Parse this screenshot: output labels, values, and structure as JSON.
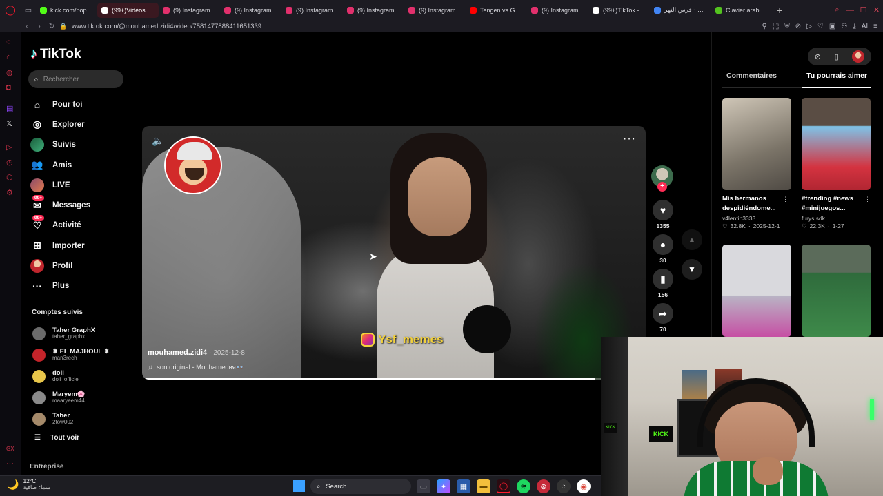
{
  "browser": {
    "tabs": [
      {
        "label": "kick.com/popout",
        "color": "#53fc18",
        "active": false
      },
      {
        "label": "(99+)Vidéos de Mouh",
        "color": "#ffffff",
        "active": true
      },
      {
        "label": "(9) Instagram",
        "color": "#e1306c",
        "active": false
      },
      {
        "label": "(9) Instagram",
        "color": "#e1306c",
        "active": false
      },
      {
        "label": "(9) Instagram",
        "color": "#e1306c",
        "active": false
      },
      {
        "label": "(9) Instagram",
        "color": "#e1306c",
        "active": false
      },
      {
        "label": "(9) Instagram",
        "color": "#e1306c",
        "active": false
      },
      {
        "label": "Tengen vs Gyut",
        "color": "#ff0000",
        "active": false
      },
      {
        "label": "(9) Instagram",
        "color": "#e1306c",
        "active": false
      },
      {
        "label": "(99+)TikTok - M",
        "color": "#ffffff",
        "active": false
      },
      {
        "label": "فرس النهر - Google",
        "color": "#4285f4",
        "active": false
      },
      {
        "label": "Clavier arabe en",
        "color": "#53c31f",
        "active": false
      }
    ],
    "url": "www.tiktok.com/@mouhamed.zidi4/video/7581477888411651339",
    "ai_label": "AI"
  },
  "tiktok": {
    "logo_text": "TikTok",
    "search_placeholder": "Rechercher",
    "nav": [
      {
        "label": "Pour toi",
        "icon": "home-icon",
        "glyph": "⌂"
      },
      {
        "label": "Explorer",
        "icon": "compass-icon",
        "glyph": "◎"
      },
      {
        "label": "Suivis",
        "icon": "following-avatar",
        "glyph": ""
      },
      {
        "label": "Amis",
        "icon": "friends-icon",
        "glyph": "👥"
      },
      {
        "label": "LIVE",
        "icon": "live-avatar",
        "glyph": ""
      },
      {
        "label": "Messages",
        "icon": "messages-icon",
        "glyph": "✉",
        "badge": "99+"
      },
      {
        "label": "Activité",
        "icon": "activity-icon",
        "glyph": "♡",
        "badge": "99+"
      },
      {
        "label": "Importer",
        "icon": "upload-icon",
        "glyph": "⊞"
      },
      {
        "label": "Profil",
        "icon": "profile-avatar",
        "glyph": ""
      },
      {
        "label": "Plus",
        "icon": "more-icon",
        "glyph": "···"
      }
    ],
    "following_title": "Comptes suivis",
    "following": [
      {
        "name": "Taher GraphX",
        "handle": "taher_graphx",
        "color": "#6b6b6b"
      },
      {
        "name": "✵ EL MAJHOUL ✵",
        "handle": "man3rech",
        "color": "#c4242a"
      },
      {
        "name": "doli",
        "handle": "doli_officiel",
        "color": "#e8c64a"
      },
      {
        "name": "Maryem🌸",
        "handle": "maaryeem44",
        "color": "#8a8a8a"
      },
      {
        "name": "Taher",
        "handle": "2tow002",
        "color": "#a58a6a"
      }
    ],
    "see_all": "Tout voir",
    "footer": "Entreprise"
  },
  "video": {
    "author": "mouhamed.zidi4",
    "date": "2025-12-8",
    "sound": "son original - Mouhamedвя👓",
    "watermark": "Ysf_memes",
    "progress_fraction": 0.9
  },
  "actions": {
    "likes": "1355",
    "comments": "30",
    "saves": "156",
    "shares": "70"
  },
  "right_panel": {
    "tabs": [
      "Commentaires",
      "Tu pourrais aimer"
    ],
    "active_tab": "Tu pourrais aimer",
    "recommendations": [
      {
        "title": "Mis hermanos despidiéndome...",
        "user": "v4lentin3333",
        "likes": "32.8K",
        "date": "2025-12-1"
      },
      {
        "title": "#trending #news #minijuegos...",
        "user": "furys.sdk",
        "likes": "22.3K",
        "date": "1-27"
      }
    ]
  },
  "webcam": {
    "sign_text": "KICK"
  },
  "taskbar": {
    "temperature": "12°C",
    "condition": "سماء صافية",
    "search": "Search"
  }
}
